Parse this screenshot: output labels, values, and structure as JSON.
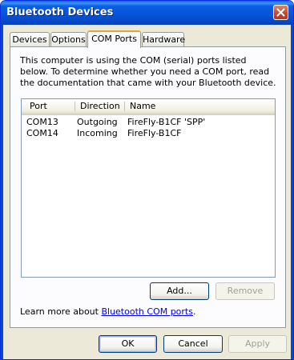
{
  "window": {
    "title": "Bluetooth Devices"
  },
  "tabs": [
    {
      "label": "Devices",
      "active": false
    },
    {
      "label": "Options",
      "active": false
    },
    {
      "label": "COM Ports",
      "active": true
    },
    {
      "label": "Hardware",
      "active": false
    }
  ],
  "panel": {
    "description": "This computer is using the COM (serial) ports listed below. To determine whether you need a COM port, read the documentation that came with your Bluetooth device.",
    "columns": {
      "port": "Port",
      "direction": "Direction",
      "name": "Name"
    },
    "rows": [
      {
        "port": "COM13",
        "direction": "Outgoing",
        "name": "FireFly-B1CF 'SPP'"
      },
      {
        "port": "COM14",
        "direction": "Incoming",
        "name": "FireFly-B1CF"
      }
    ],
    "add_label": "Add...",
    "remove_label": "Remove",
    "learn_prefix": "Learn more about ",
    "learn_link": "Bluetooth COM ports",
    "learn_suffix": "."
  },
  "footer": {
    "ok_label": "OK",
    "cancel_label": "Cancel",
    "apply_label": "Apply"
  },
  "colors": {
    "titlebar": "#0653d8",
    "face": "#ece9d8",
    "active_tab_accent": "#e8a23a",
    "link": "#0000ee"
  },
  "icons": {
    "close": "close-icon"
  }
}
